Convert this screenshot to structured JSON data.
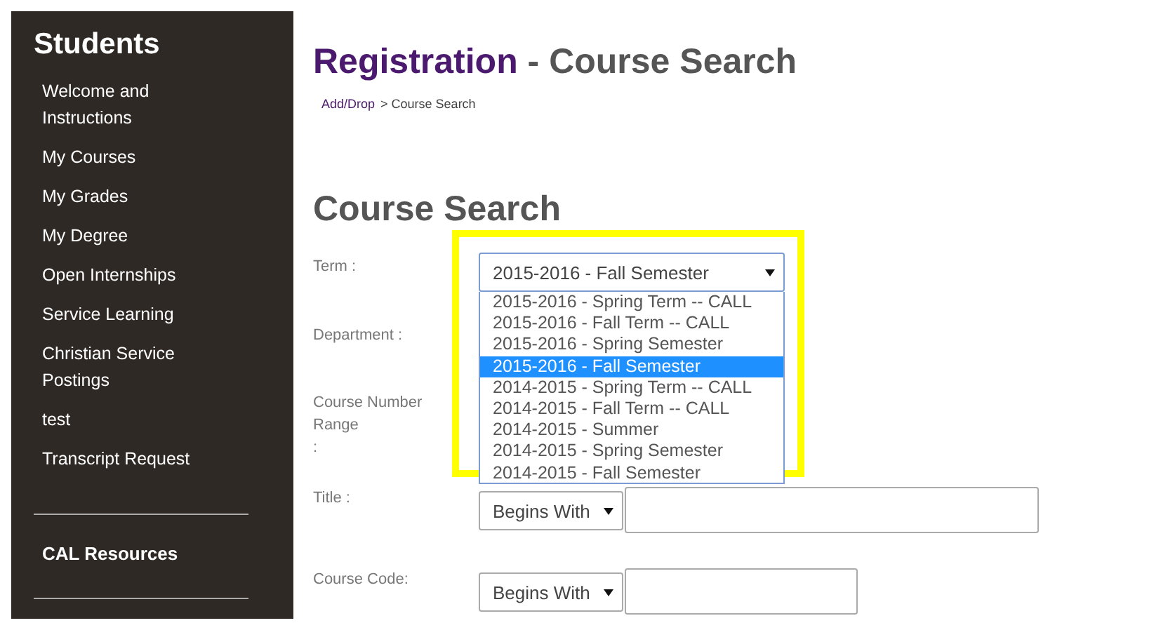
{
  "sidebar": {
    "title": "Students",
    "items": [
      {
        "label": "Welcome and Instructions"
      },
      {
        "label": "My Courses"
      },
      {
        "label": "My Grades"
      },
      {
        "label": "My Degree"
      },
      {
        "label": "Open Internships"
      },
      {
        "label": "Service Learning"
      },
      {
        "label": "Christian Service Postings"
      },
      {
        "label": "test"
      },
      {
        "label": "Transcript Request"
      }
    ],
    "section": "CAL Resources"
  },
  "page_title": {
    "main": "Registration",
    "sub": " - Course Search"
  },
  "breadcrumb": {
    "link": "Add/Drop",
    "current": "> Course Search"
  },
  "heading": "Course Search",
  "form": {
    "term": {
      "label": "Term :",
      "value": "2015-2016 - Fall Semester",
      "expanded": true,
      "highlighted": true,
      "options": [
        {
          "label": "2015-2016 - Spring Term -- CALL",
          "selected": false
        },
        {
          "label": "2015-2016 - Fall Term -- CALL",
          "selected": false
        },
        {
          "label": "2015-2016 - Spring Semester",
          "selected": false
        },
        {
          "label": "2015-2016 - Fall Semester",
          "selected": true
        },
        {
          "label": "2014-2015 - Spring Term -- CALL",
          "selected": false
        },
        {
          "label": "2014-2015 - Fall Term -- CALL",
          "selected": false
        },
        {
          "label": "2014-2015 - Summer",
          "selected": false
        },
        {
          "label": "2014-2015 - Spring Semester",
          "selected": false
        },
        {
          "label": "2014-2015 - Fall Semester",
          "selected": false
        }
      ]
    },
    "department": {
      "label": "Department :"
    },
    "course_number": {
      "label": "Course Number Range",
      ":": ":"
    },
    "title": {
      "label": "Title :",
      "match": "Begins With"
    },
    "course_code": {
      "label": "Course Code:",
      "match": "Begins With"
    }
  }
}
